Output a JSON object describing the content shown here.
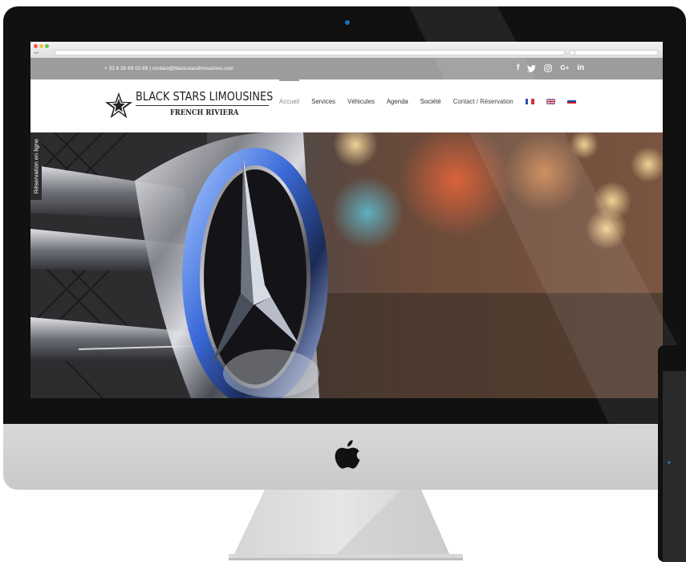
{
  "browser": {
    "url": "",
    "search_placeholder": "Q"
  },
  "topbar": {
    "contact": "+ 33 6 26 69 02 89  |  contact@blackstarslimousines.com",
    "socials": [
      {
        "icon": "facebook-icon",
        "glyph": "f"
      },
      {
        "icon": "twitter-icon",
        "glyph": "🐦"
      },
      {
        "icon": "instagram-icon",
        "glyph": "◎"
      },
      {
        "icon": "google-plus-icon",
        "glyph": "G+"
      },
      {
        "icon": "linkedin-icon",
        "glyph": "in"
      }
    ]
  },
  "header": {
    "logo_title": "BLACK STARS LIMOUSINES",
    "logo_subtitle": "FRENCH RIVIERA",
    "menu": [
      {
        "label": "Accueil",
        "active": true
      },
      {
        "label": "Services"
      },
      {
        "label": "Véhicules"
      },
      {
        "label": "Agenda"
      },
      {
        "label": "Société"
      },
      {
        "label": "Contact / Réservation"
      }
    ],
    "languages": [
      {
        "code": "fr",
        "colors": [
          "#1f3fa8",
          "#ffffff",
          "#d3202c"
        ]
      },
      {
        "code": "en",
        "colors": [
          "#1f3fa8",
          "#ffffff",
          "#d3202c"
        ]
      },
      {
        "code": "ru",
        "colors": [
          "#ffffff",
          "#1f3fa8",
          "#d3202c"
        ]
      }
    ]
  },
  "hero": {
    "side_tab": "Réservation en ligne"
  },
  "colors": {
    "topbar": "#9c9c9c",
    "bezel": "#111111",
    "chin": "#d4d4d4",
    "camera": "#1b6fb3"
  }
}
